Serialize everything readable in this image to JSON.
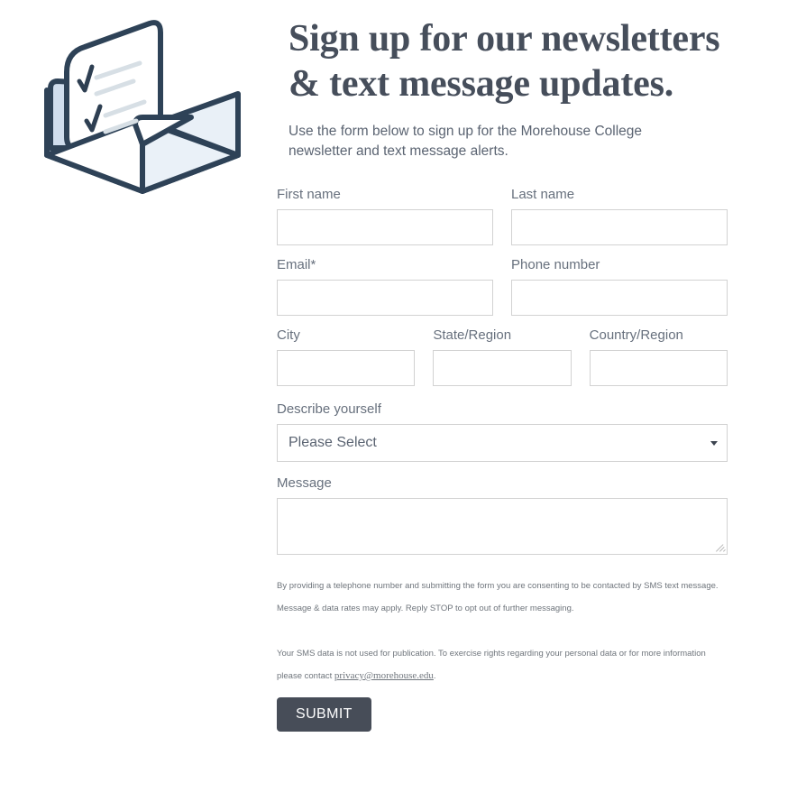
{
  "illustration": {
    "name": "open-envelope-with-checklist-letter",
    "outline_color": "#2e4257",
    "paper_color": "#ffffff",
    "envelope_fill": "#dce7f2",
    "envelope_shadow": "#c6d6e6",
    "line_color": "#d7dfe5",
    "check_color": "#2e3f52"
  },
  "header": {
    "headline": "Sign up for our newsletters & text message updates.",
    "subhead": "Use the form below to sign up for the Morehouse College newsletter and text message alerts.",
    "headline_color": "#464e5b"
  },
  "form": {
    "rows": [
      {
        "fields": [
          {
            "label": "First name",
            "required": false,
            "value": "",
            "placeholder": "",
            "name": "first-name"
          },
          {
            "label": "Last name",
            "required": false,
            "value": "",
            "placeholder": "",
            "name": "last-name"
          }
        ]
      },
      {
        "fields": [
          {
            "label": "Email",
            "required": true,
            "value": "",
            "placeholder": "",
            "name": "email"
          },
          {
            "label": "Phone number",
            "required": false,
            "value": "",
            "placeholder": "",
            "name": "phone-number"
          }
        ]
      },
      {
        "fields": [
          {
            "label": "City",
            "required": false,
            "value": "",
            "placeholder": "",
            "name": "city"
          },
          {
            "label": "State/Region",
            "required": false,
            "value": "",
            "placeholder": "",
            "name": "state-region"
          },
          {
            "label": "Country/Region",
            "required": false,
            "value": "",
            "placeholder": "",
            "name": "country-region"
          }
        ]
      }
    ],
    "required_marker": "*",
    "describe": {
      "label": "Describe yourself",
      "selected": "Please Select",
      "icon": "chevron-down-icon"
    },
    "message": {
      "label": "Message",
      "value": "",
      "placeholder": ""
    }
  },
  "legal": {
    "paragraph_1": "By providing a telephone number and submitting the form you are consenting to be contacted by SMS text message. Message & data rates may apply. Reply STOP to opt out of further messaging.",
    "paragraph_2_before": "Your SMS data is not used for publication. To exercise rights regarding your personal data or for more information please contact ",
    "paragraph_2_link": "privacy@morehouse.edu",
    "paragraph_2_after": "."
  },
  "submit": {
    "label": "SUBMIT",
    "background": "#474d58",
    "text_color": "#ffffff"
  }
}
